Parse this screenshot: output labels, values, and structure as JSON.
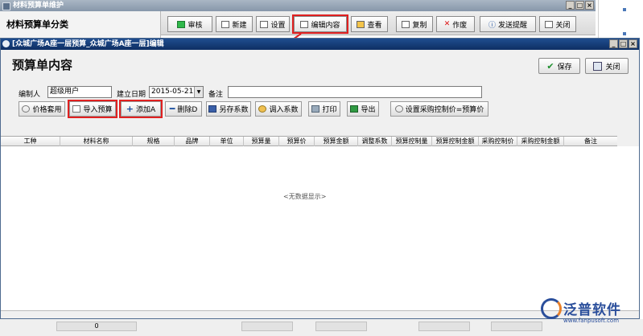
{
  "bg_window": {
    "title": "材料预算单维护",
    "left_title": "材料预算单分类",
    "toolbar": [
      {
        "label": "审核",
        "icon": "green-light-icon"
      },
      {
        "label": "新建",
        "icon": "new-doc-icon"
      },
      {
        "label": "设置",
        "icon": "settings-icon"
      },
      {
        "label": "编辑内容",
        "icon": "edit-icon"
      },
      {
        "label": "查看",
        "icon": "view-icon"
      },
      {
        "label": "复制",
        "icon": "copy-icon"
      },
      {
        "label": "作废",
        "icon": "void-x-icon"
      },
      {
        "label": "发送提醒",
        "icon": "info-icon"
      },
      {
        "label": "关闭",
        "icon": "close-door-icon"
      }
    ]
  },
  "dialog": {
    "title": "[众城广场A座一层预算_众城广场A座一层]编辑",
    "heading": "预算单内容",
    "save_label": "保存",
    "close_label": "关闭",
    "form": {
      "editor_label": "编制人",
      "editor_value": "超级用户",
      "date_label": "建立日期",
      "date_value": "2015-05-21",
      "remark_label": "备注",
      "remark_value": ""
    },
    "actions": [
      {
        "label": "价格套用"
      },
      {
        "label": "导入预算"
      },
      {
        "label": "添加A"
      },
      {
        "label": "删除D"
      },
      {
        "label": "另存系数"
      },
      {
        "label": "调入系数"
      },
      {
        "label": "打印"
      },
      {
        "label": "导出"
      },
      {
        "label": "设置采购控制价=预算价"
      }
    ],
    "columns": [
      "工种",
      "材料名称",
      "规格",
      "品牌",
      "单位",
      "预算量",
      "预算价",
      "预算金额",
      "调整系数",
      "预算控制量",
      "预算控制金额",
      "采购控制价",
      "采购控制金额",
      "备注"
    ],
    "empty_text": "<无数据显示>"
  },
  "status": {
    "count": "0"
  },
  "logo": {
    "name": "泛普软件",
    "url": "www.fanpusoft.com"
  },
  "colors": {
    "highlight": "#e02020",
    "dialog_title": "#0e2f63"
  }
}
